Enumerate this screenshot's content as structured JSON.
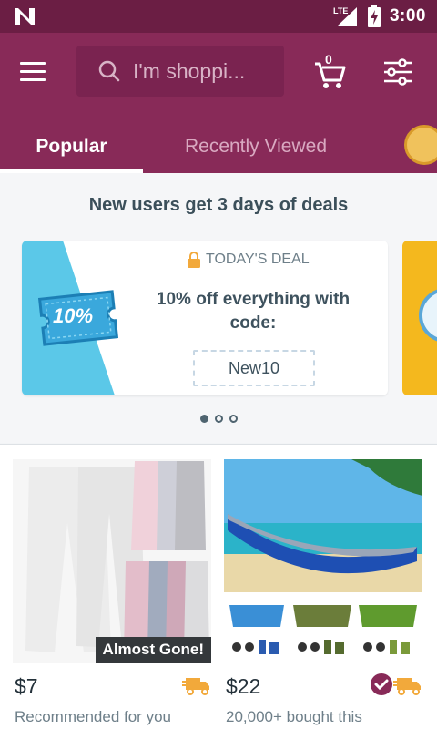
{
  "status_bar": {
    "time": "3:00",
    "network": "LTE"
  },
  "header": {
    "search_placeholder": "I'm shoppi...",
    "cart_count": "0",
    "tabs": [
      {
        "label": "Popular",
        "active": true
      },
      {
        "label": "Recently Viewed",
        "active": false
      }
    ]
  },
  "deals": {
    "heading": "New users get 3 days of deals",
    "card": {
      "badge": "10%",
      "label": "TODAY'S DEAL",
      "title": "10% off everything with code:",
      "code": "New10"
    },
    "pagination": {
      "count": 3,
      "active_index": 0
    }
  },
  "products": [
    {
      "price": "$7",
      "subtext": "Recommended for you",
      "tag": "Almost Gone!",
      "verified": false
    },
    {
      "price": "$22",
      "subtext": "20,000+ bought this",
      "tag": "",
      "verified": true
    }
  ],
  "colors": {
    "status_bar": "#6b1e44",
    "header": "#882a58",
    "accent_orange": "#f2a93b",
    "deal_blue": "#5bc8e8",
    "text_dark": "#3e525e"
  }
}
